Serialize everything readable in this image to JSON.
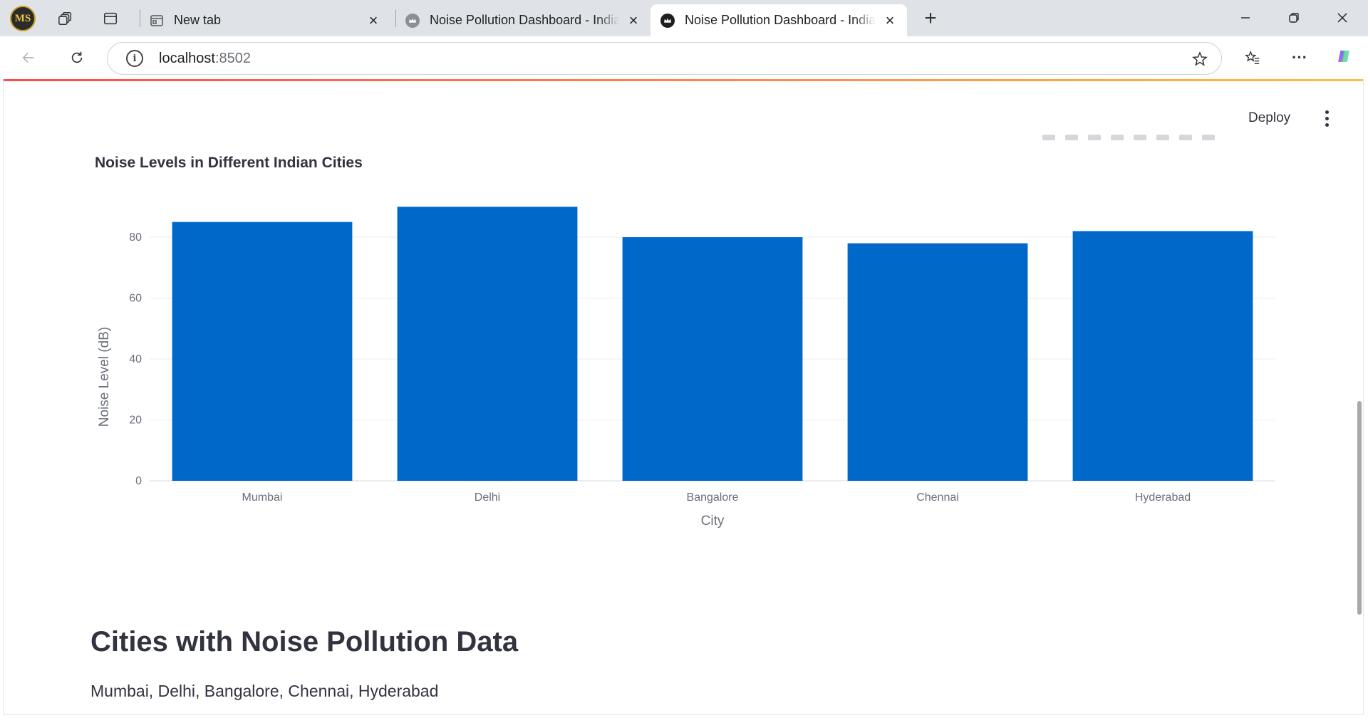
{
  "browser": {
    "profile_initials": "MS",
    "tabs": [
      {
        "title": "New tab",
        "active": false
      },
      {
        "title": "Noise Pollution Dashboard - India",
        "active": false
      },
      {
        "title": "Noise Pollution Dashboard - India",
        "active": true
      }
    ],
    "address": {
      "host": "localhost",
      "port": ":8502"
    }
  },
  "app": {
    "deploy_label": "Deploy",
    "section_heading": "Cities with Noise Pollution Data",
    "cities_text": "Mumbai, Delhi, Bangalore, Chennai, Hyderabad"
  },
  "chart_data": {
    "type": "bar",
    "title": "Noise Levels in Different Indian Cities",
    "categories": [
      "Mumbai",
      "Delhi",
      "Bangalore",
      "Chennai",
      "Hyderabad"
    ],
    "values": [
      85,
      90,
      80,
      78,
      82
    ],
    "xlabel": "City",
    "ylabel": "Noise Level (dB)",
    "ylim": [
      0,
      95
    ],
    "yticks": [
      0,
      20,
      40,
      60,
      80
    ],
    "bar_color": "#0068c9",
    "grid": true
  }
}
